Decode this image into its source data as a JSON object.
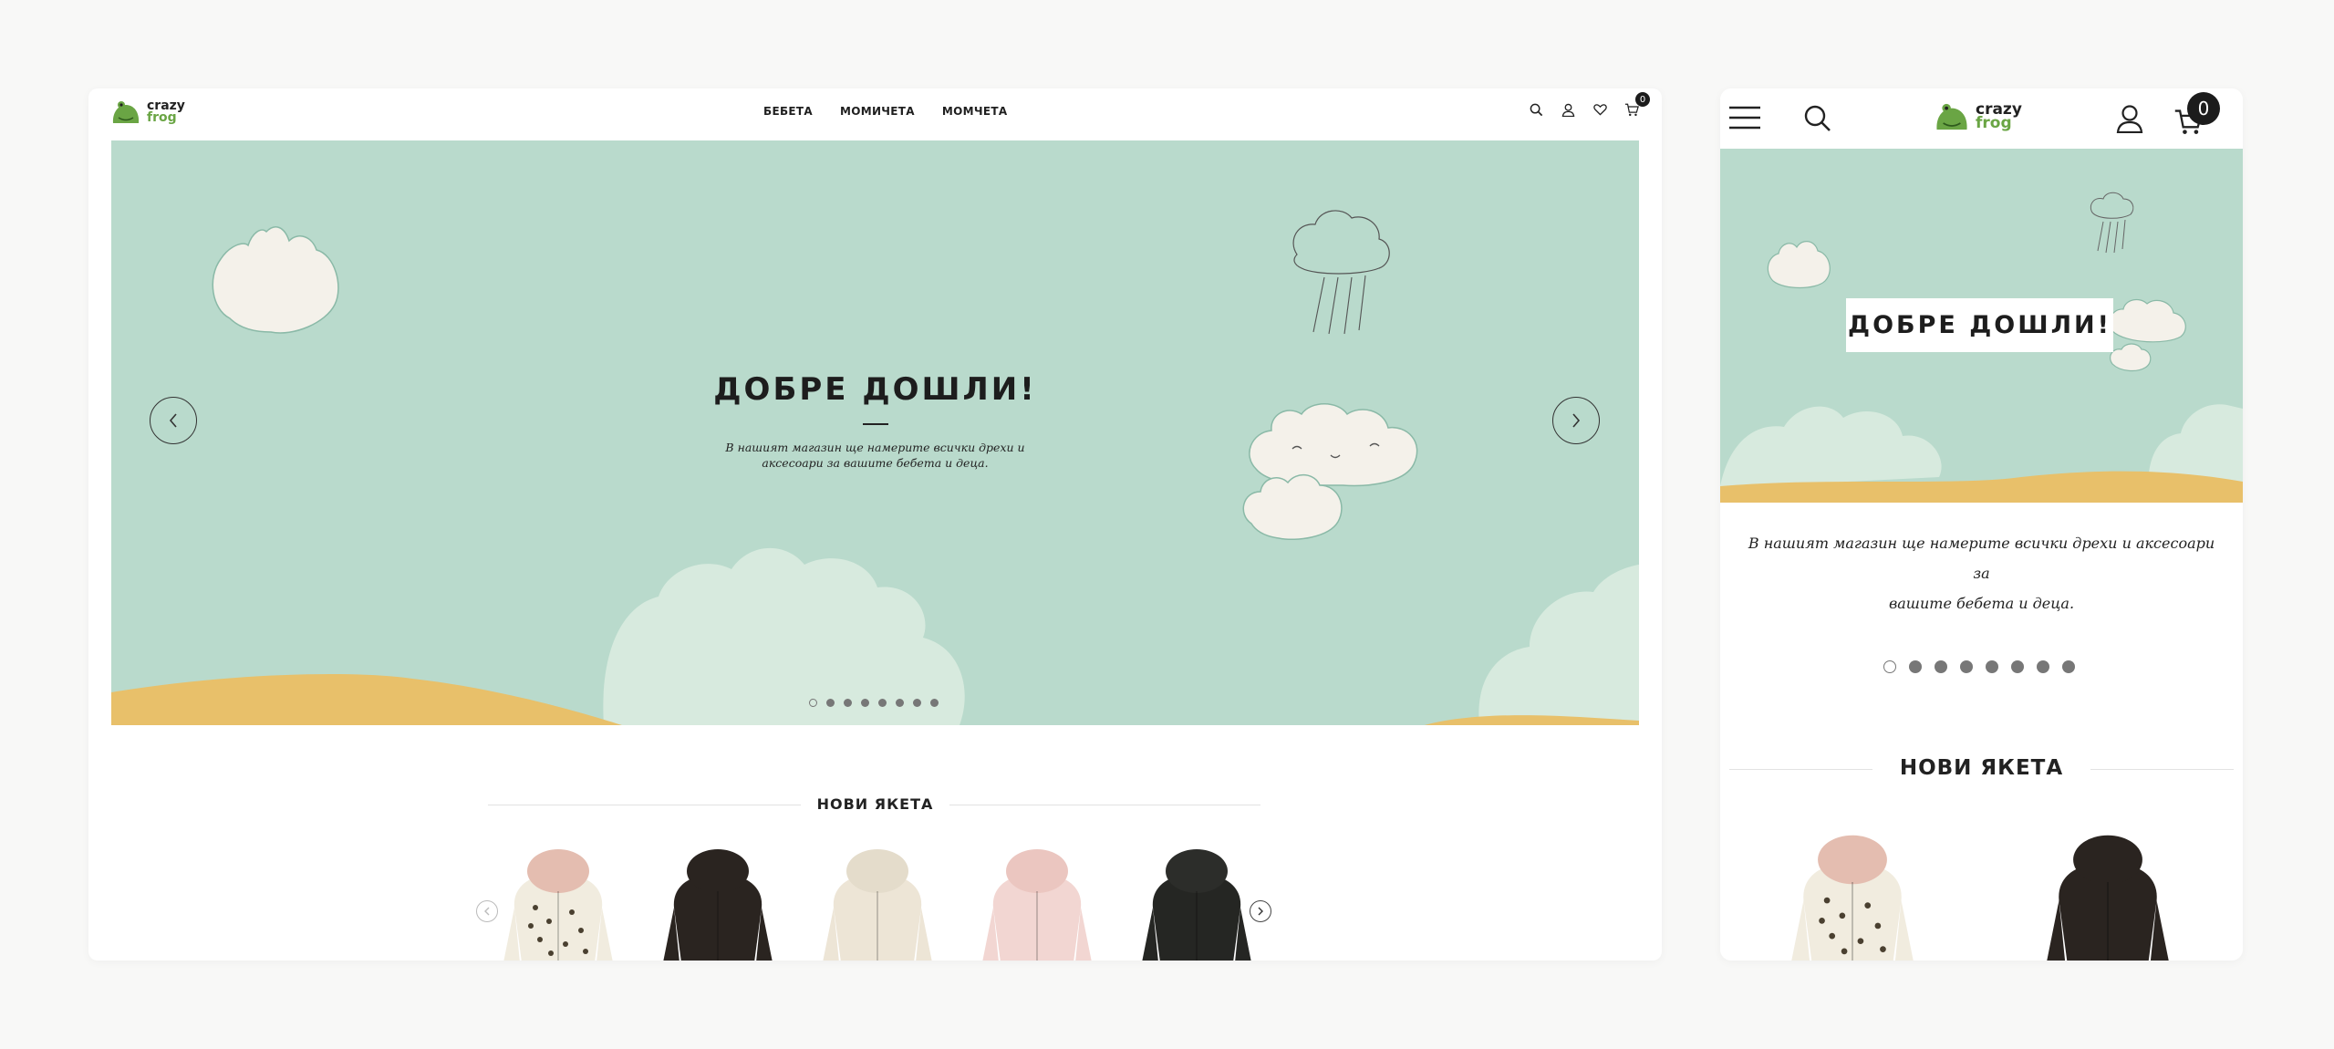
{
  "brand": {
    "line1": "crazy",
    "line2": "frog"
  },
  "desktop": {
    "nav": [
      "БЕБЕТА",
      "МОМИЧЕТА",
      "МОМЧЕТА"
    ],
    "cart_count": "0",
    "hero": {
      "title": "ДОБРЕ ДОШЛИ!",
      "subtitle_line1": "В нашият магазин ще намерите всички дрехи и",
      "subtitle_line2": "аксесоари за вашите бебета и деца.",
      "slide_count": 8,
      "active_slide": 1
    },
    "section_title": "НОВИ ЯКЕТА"
  },
  "mobile": {
    "cart_count": "0",
    "hero_title": "ДОБРЕ ДОШЛИ!",
    "subtitle_line1": "В нашият магазин ще намерите всички дрехи и аксесоари за",
    "subtitle_line2": "вашите бебета и деца.",
    "section_title": "НОВИ ЯКЕТА",
    "slide_count": 8,
    "active_slide": 1
  },
  "products": [
    {
      "name": "floral-fur-hood-jacket",
      "body": "#f1ecdf",
      "hood": "#e4bdb0",
      "pattern": true
    },
    {
      "name": "black-denim-jacket",
      "body": "#2a2420",
      "hood": "#2a2420",
      "pattern": false
    },
    {
      "name": "cream-hooded-jacket",
      "body": "#ede5d6",
      "hood": "#e4dccb",
      "pattern": false
    },
    {
      "name": "pink-fur-jacket",
      "body": "#f2d6d2",
      "hood": "#ebc6c0",
      "pattern": false
    },
    {
      "name": "black-fur-jacket",
      "body": "#252623",
      "hood": "#2c2d2a",
      "pattern": false
    }
  ],
  "colors": {
    "hero_bg": "#b9dacc",
    "sand": "#e8c06a",
    "light_cloud": "#d7eade",
    "cloud_fill": "#f4f1ea",
    "brand_green": "#6aa544",
    "page_bg": "#f8f8f7"
  }
}
